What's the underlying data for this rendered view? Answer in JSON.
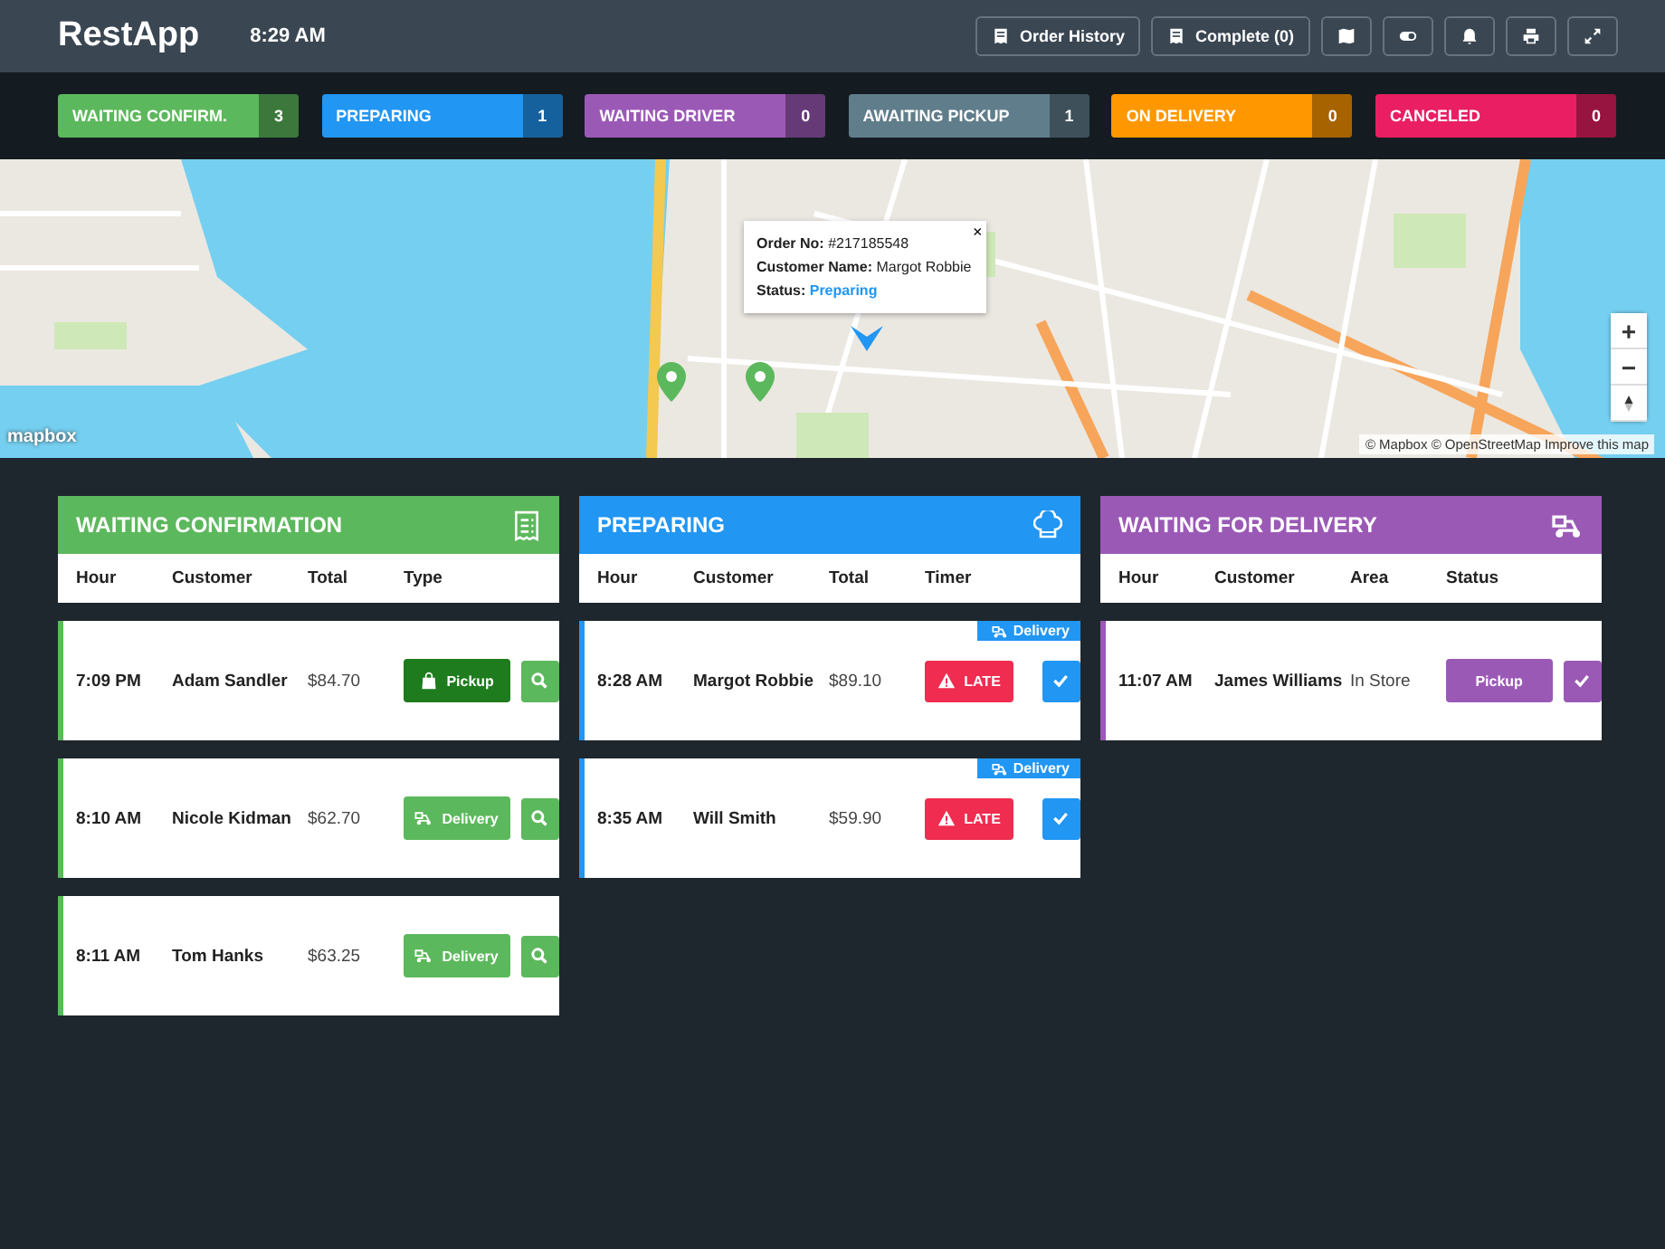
{
  "header": {
    "logo": "RestApp",
    "time": "8:29 AM",
    "buttons": [
      {
        "kind": "history",
        "label": "Order History"
      },
      {
        "kind": "complete",
        "label": "Complete (0)"
      },
      {
        "kind": "map"
      },
      {
        "kind": "toggle"
      },
      {
        "kind": "bell"
      },
      {
        "kind": "print"
      },
      {
        "kind": "expand"
      }
    ]
  },
  "statuses": [
    {
      "label": "WAITING CONFIRM.",
      "count": "3",
      "color": "#5cb85c"
    },
    {
      "label": "PREPARING",
      "count": "1",
      "color": "#2196f3"
    },
    {
      "label": "WAITING DRIVER",
      "count": "0",
      "color": "#9b59b6"
    },
    {
      "label": "AWAITING PICKUP",
      "count": "1",
      "color": "#607d8b"
    },
    {
      "label": "ON DELIVERY",
      "count": "0",
      "color": "#ff9800"
    },
    {
      "label": "CANCELED",
      "count": "0",
      "color": "#e91e63"
    }
  ],
  "map": {
    "popup": {
      "order_label": "Order No:",
      "order_no": "#217185548",
      "customer_label": "Customer Name:",
      "customer": "Margot Robbie",
      "status_label": "Status:",
      "status": "Preparing",
      "close": "×"
    },
    "zoom_in": "+",
    "zoom_out": "−",
    "logo": "mapbox",
    "attribution": "© Mapbox © OpenStreetMap",
    "improve_link": "Improve this map"
  },
  "panels": [
    {
      "kind": "confirmation",
      "title": "WAITING CONFIRMATION",
      "color": "#5cb85c",
      "columns": [
        "Hour",
        "Customer",
        "Total",
        "Type"
      ],
      "rows": [
        {
          "hour": "7:09 PM",
          "customer": "Adam Sandler",
          "total": "$84.70",
          "type": {
            "kind": "pickup",
            "label": "Pickup",
            "selected": true
          }
        },
        {
          "hour": "8:10 AM",
          "customer": "Nicole Kidman",
          "total": "$62.70",
          "type": {
            "kind": "delivery",
            "label": "Delivery",
            "selected": false
          }
        },
        {
          "hour": "8:11 AM",
          "customer": "Tom Hanks",
          "total": "$63.25",
          "type": {
            "kind": "delivery",
            "label": "Delivery",
            "selected": false
          }
        }
      ]
    },
    {
      "kind": "preparing",
      "title": "PREPARING",
      "color": "#2196f3",
      "columns": [
        "Hour",
        "Customer",
        "Total",
        "Timer"
      ],
      "rows": [
        {
          "hour": "8:28 AM",
          "customer": "Margot Robbie",
          "total": "$89.10",
          "tag": "Delivery",
          "timer": "LATE"
        },
        {
          "hour": "8:35 AM",
          "customer": "Will Smith",
          "total": "$59.90",
          "tag": "Delivery",
          "timer": "LATE"
        }
      ]
    },
    {
      "kind": "delivery",
      "title": "WAITING FOR DELIVERY",
      "color": "#9b59b6",
      "columns": [
        "Hour",
        "Customer",
        "Area",
        "Status"
      ],
      "rows": [
        {
          "hour": "11:07 AM",
          "customer": "James Williams",
          "area": "In Store",
          "status": "Pickup"
        }
      ]
    }
  ]
}
